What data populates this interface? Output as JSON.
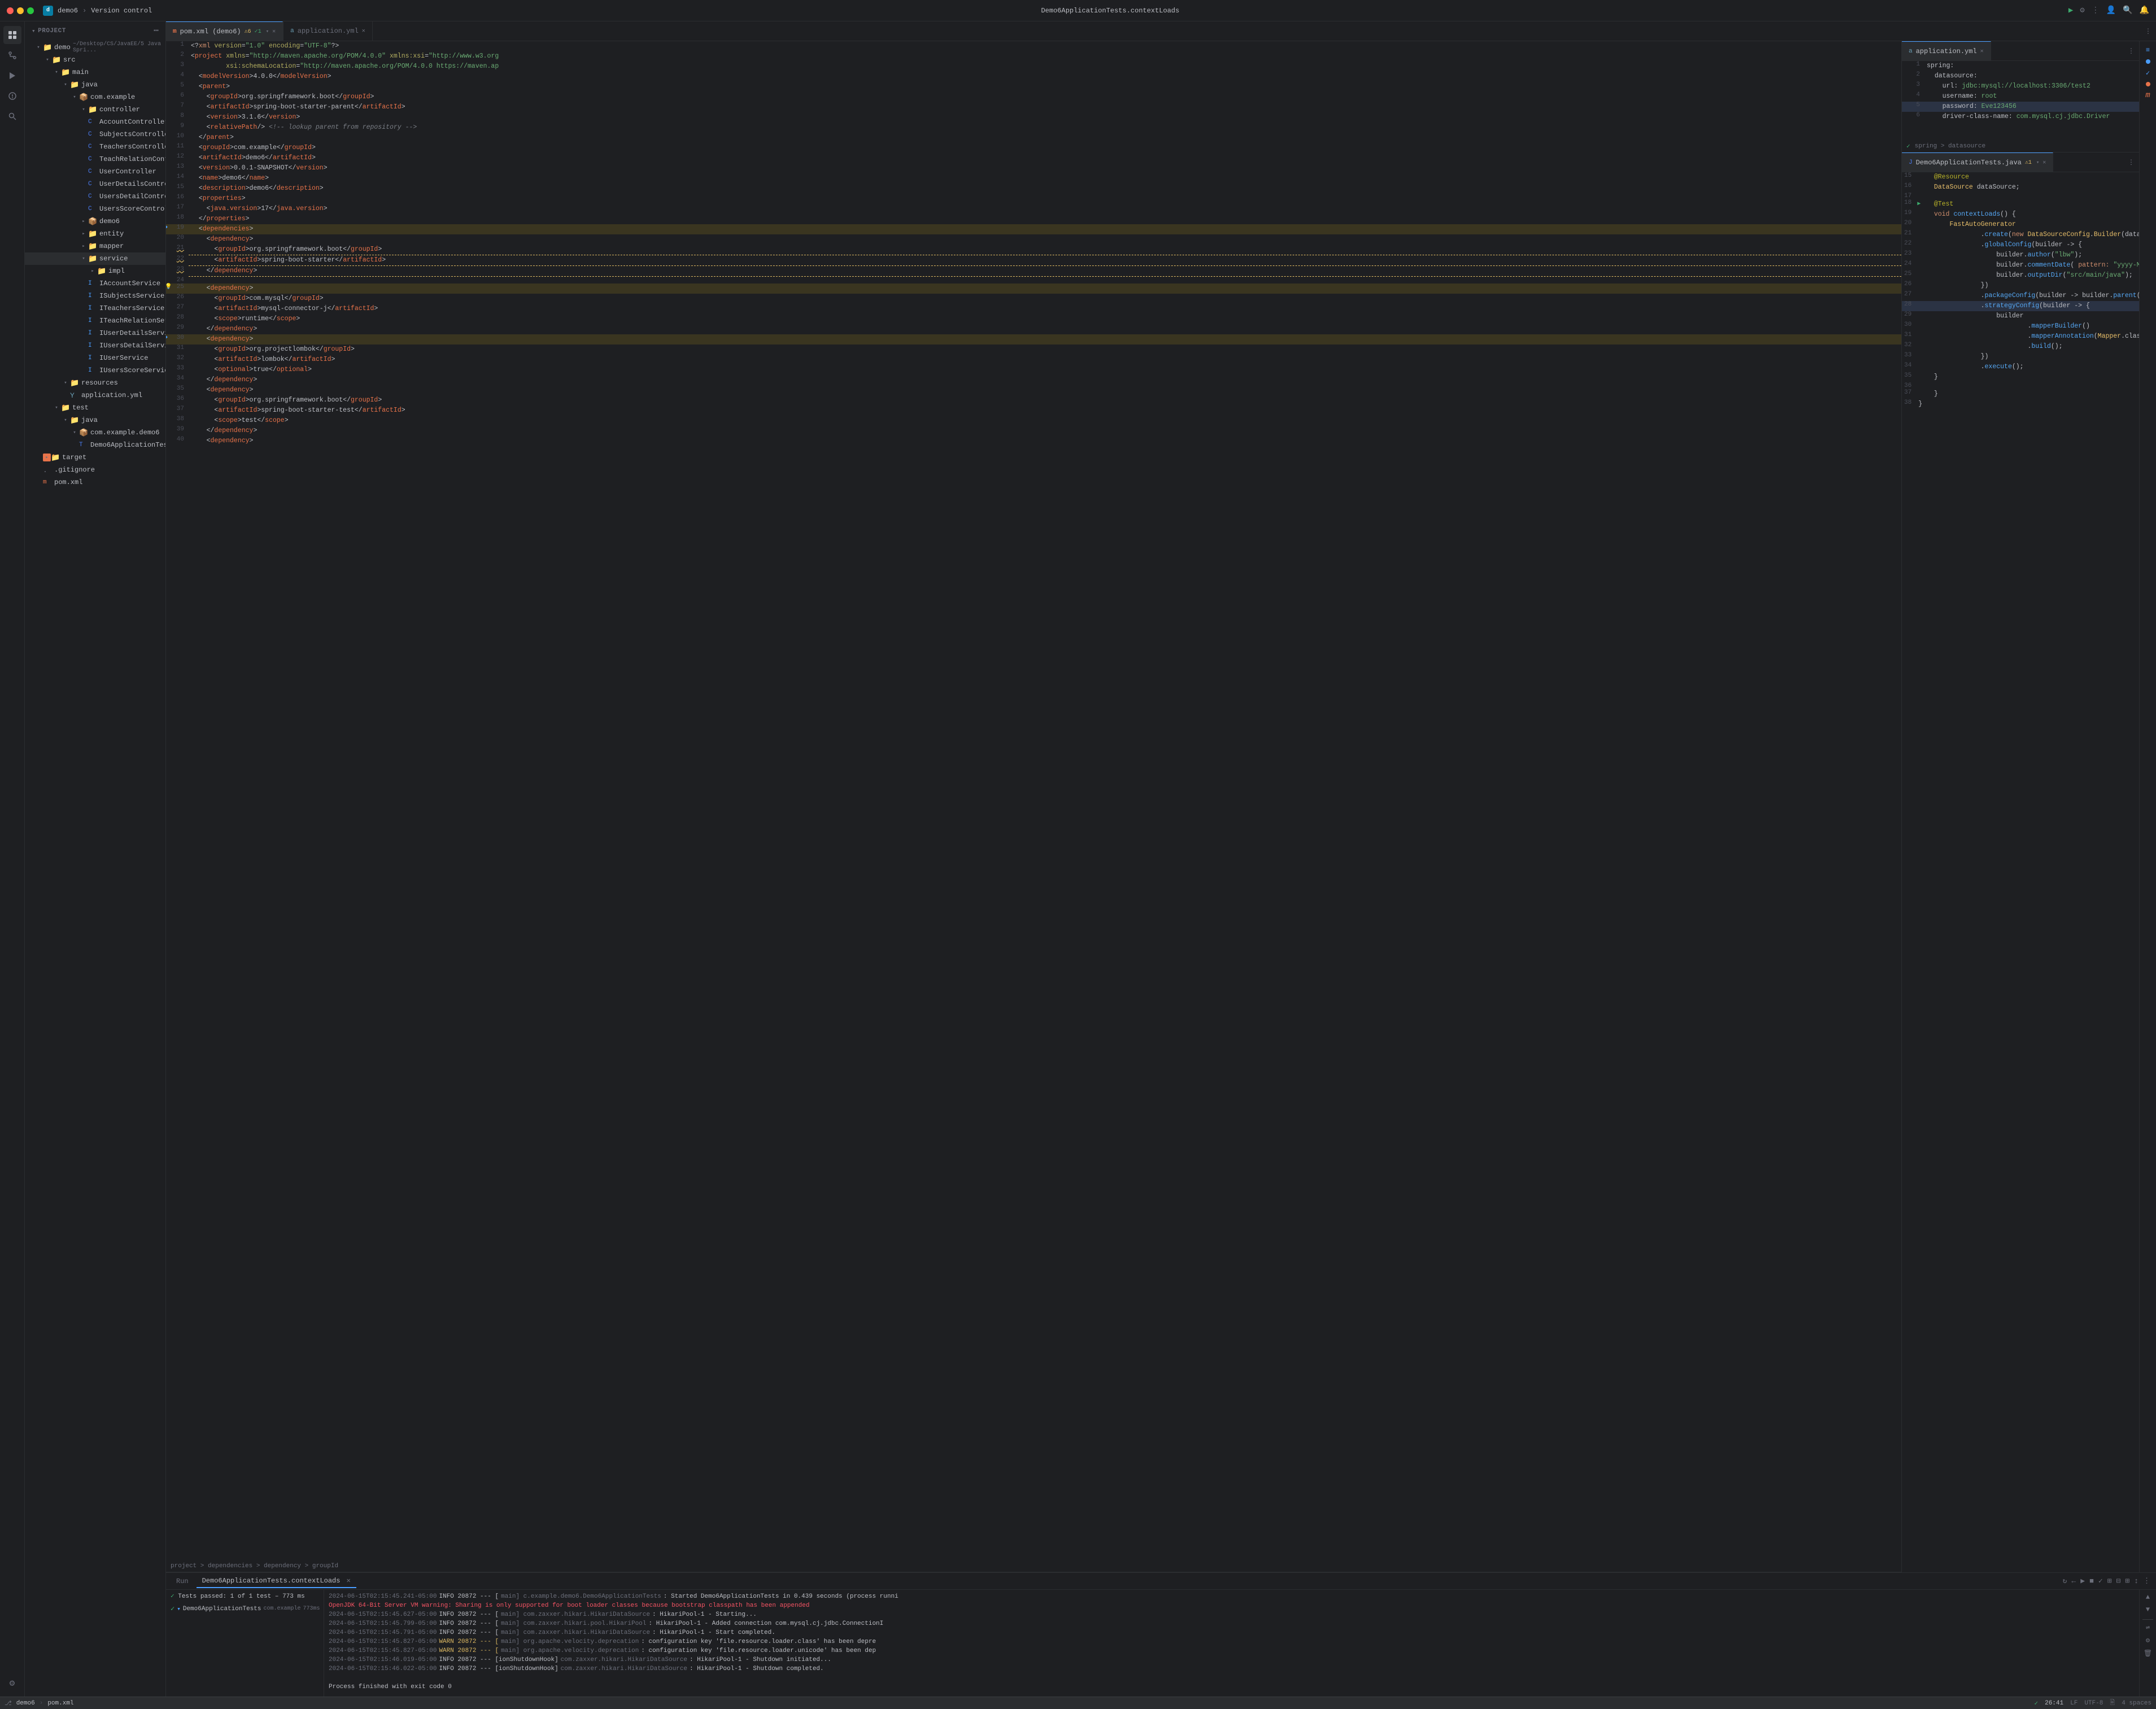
{
  "titlebar": {
    "project": "demo6",
    "version_control": "Version control",
    "center_title": "Demo6ApplicationTests.contextLoads",
    "run_icon": "▶",
    "settings_icon": "⚙",
    "more_icon": "⋮",
    "user_icon": "👤",
    "search_icon": "🔍",
    "notifications_icon": "🔔"
  },
  "sidebar": {
    "header": "Project",
    "project_name": "demo6",
    "project_path": "~/Desktop/CS/JavaEE/5 Java Spri...",
    "tree": [
      {
        "id": "demo6-root",
        "label": "demo6",
        "type": "root",
        "indent": 0,
        "expanded": true
      },
      {
        "id": "src",
        "label": "src",
        "type": "folder",
        "indent": 1,
        "expanded": true
      },
      {
        "id": "main",
        "label": "main",
        "type": "folder",
        "indent": 2,
        "expanded": true
      },
      {
        "id": "java",
        "label": "java",
        "type": "folder",
        "indent": 3,
        "expanded": true
      },
      {
        "id": "com.example",
        "label": "com.example",
        "type": "package",
        "indent": 4,
        "expanded": true
      },
      {
        "id": "controller",
        "label": "controller",
        "type": "folder",
        "indent": 5,
        "expanded": true
      },
      {
        "id": "AccountController",
        "label": "AccountController",
        "type": "java",
        "indent": 6
      },
      {
        "id": "SubjectsController",
        "label": "SubjectsController",
        "type": "java",
        "indent": 6
      },
      {
        "id": "TeachersController",
        "label": "TeachersController",
        "type": "java",
        "indent": 6
      },
      {
        "id": "TeachRelationController",
        "label": "TeachRelationController",
        "type": "java",
        "indent": 6
      },
      {
        "id": "UserController",
        "label": "UserController",
        "type": "java",
        "indent": 6
      },
      {
        "id": "UserDetailsController",
        "label": "UserDetailsController",
        "type": "java",
        "indent": 6
      },
      {
        "id": "UsersDetailController",
        "label": "UsersDetailController",
        "type": "java",
        "indent": 6
      },
      {
        "id": "UsersScoreController",
        "label": "UsersScoreController",
        "type": "java",
        "indent": 6
      },
      {
        "id": "demo6-pkg",
        "label": "demo6",
        "type": "package",
        "indent": 5,
        "expanded": false
      },
      {
        "id": "entity",
        "label": "entity",
        "type": "folder",
        "indent": 5,
        "expanded": false
      },
      {
        "id": "mapper",
        "label": "mapper",
        "type": "folder",
        "indent": 5,
        "expanded": false
      },
      {
        "id": "service",
        "label": "service",
        "type": "folder",
        "indent": 5,
        "expanded": true
      },
      {
        "id": "impl",
        "label": "impl",
        "type": "folder",
        "indent": 6,
        "expanded": false
      },
      {
        "id": "IAccountService",
        "label": "IAccountService",
        "type": "interface",
        "indent": 6
      },
      {
        "id": "ISubjectsService",
        "label": "ISubjectsService",
        "type": "interface",
        "indent": 6
      },
      {
        "id": "ITeachersService",
        "label": "ITeachersService",
        "type": "interface",
        "indent": 6
      },
      {
        "id": "ITeachRelationService",
        "label": "ITeachRelationService",
        "type": "interface",
        "indent": 6
      },
      {
        "id": "IUserDetailsService",
        "label": "IUserDetailsService",
        "type": "interface",
        "indent": 6
      },
      {
        "id": "IUsersDetailService",
        "label": "IUsersDetailService",
        "type": "interface",
        "indent": 6
      },
      {
        "id": "IUserService",
        "label": "IUserService",
        "type": "interface",
        "indent": 6
      },
      {
        "id": "IUsersScoreService",
        "label": "IUsersScoreService",
        "type": "interface",
        "indent": 6
      },
      {
        "id": "resources",
        "label": "resources",
        "type": "folder",
        "indent": 3,
        "expanded": true
      },
      {
        "id": "application.yml",
        "label": "application.yml",
        "type": "yaml",
        "indent": 4
      },
      {
        "id": "test",
        "label": "test",
        "type": "folder",
        "indent": 2,
        "expanded": true
      },
      {
        "id": "java-test",
        "label": "java",
        "type": "folder",
        "indent": 3,
        "expanded": true
      },
      {
        "id": "com.example.demo6",
        "label": "com.example.demo6",
        "type": "package",
        "indent": 4,
        "expanded": true
      },
      {
        "id": "Demo6ApplicationTests",
        "label": "Demo6ApplicationTests",
        "type": "java",
        "indent": 5
      },
      {
        "id": "target",
        "label": "target",
        "type": "folder",
        "indent": 1,
        "expanded": false
      },
      {
        "id": ".gitignore",
        "label": ".gitignore",
        "type": "git",
        "indent": 1
      },
      {
        "id": "pom.xml",
        "label": "pom.xml",
        "type": "xml",
        "indent": 1
      }
    ]
  },
  "editor": {
    "tabs": [
      {
        "id": "pom-xml",
        "label": "pom.xml (demo6)",
        "type": "xml",
        "active": true,
        "modified": false
      },
      {
        "id": "application-yml",
        "label": "application.yml",
        "type": "yaml",
        "active": false,
        "modified": false
      },
      {
        "id": "demo6-tests",
        "label": "Demo6ApplicationTests.java",
        "type": "java",
        "active": false,
        "modified": false
      }
    ],
    "pom_lines": [
      {
        "n": 1,
        "code": "<?xml version=\"1.0\" encoding=\"UTF-8\"?>"
      },
      {
        "n": 2,
        "code": "<project xmlns=\"http://maven.apache.org/POM/4.0.0\" xmlns:xsi=\"http://www.w3.org"
      },
      {
        "n": 3,
        "code": "         xsi:schemaLocation=\"http://maven.apache.org/POM/4.0.0 https://maven.ap"
      },
      {
        "n": 4,
        "code": "  <modelVersion>4.0.0</modelVersion>"
      },
      {
        "n": 5,
        "code": "  <parent>"
      },
      {
        "n": 6,
        "code": "    <groupId>org.springframework.boot</groupId>"
      },
      {
        "n": 7,
        "code": "    <artifactId>spring-boot-starter-parent</artifactId>"
      },
      {
        "n": 8,
        "code": "    <version>3.1.6</version>"
      },
      {
        "n": 9,
        "code": "    <relativePath/> <!-- lookup parent from repository -->"
      },
      {
        "n": 10,
        "code": "  </parent>"
      },
      {
        "n": 11,
        "code": "  <groupId>com.example</groupId>"
      },
      {
        "n": 12,
        "code": "  <artifactId>demo6</artifactId>"
      },
      {
        "n": 13,
        "code": "  <version>0.0.1-SNAPSHOT</version>"
      },
      {
        "n": 14,
        "code": "  <name>demo6</name>"
      },
      {
        "n": 15,
        "code": "  <description>demo6</description>"
      },
      {
        "n": 16,
        "code": "  <properties>"
      },
      {
        "n": 17,
        "code": "    <java.version>17</java.version>"
      },
      {
        "n": 18,
        "code": "  </properties>"
      },
      {
        "n": 19,
        "code": "  <dependencies>"
      },
      {
        "n": 20,
        "code": "    <dependency>"
      },
      {
        "n": 21,
        "code": "      <groupId>org.springframework.boot</groupId>"
      },
      {
        "n": 22,
        "code": "      <artifactId>spring-boot-starter</artifactId>"
      },
      {
        "n": 23,
        "code": "    </dependency>"
      },
      {
        "n": 24,
        "code": ""
      },
      {
        "n": 25,
        "code": "    <dependency>"
      },
      {
        "n": 26,
        "code": "      <groupId>com.mysql</groupId>"
      },
      {
        "n": 27,
        "code": "      <artifactId>mysql-connector-j</artifactId>"
      },
      {
        "n": 28,
        "code": "      <scope>runtime</scope>"
      },
      {
        "n": 29,
        "code": "    </dependency>"
      },
      {
        "n": 30,
        "code": "    <dependency>"
      },
      {
        "n": 31,
        "code": "      <groupId>org.projectlombok</groupId>"
      },
      {
        "n": 32,
        "code": "      <artifactId>lombok</artifactId>"
      },
      {
        "n": 33,
        "code": "      <optional>true</optional>"
      },
      {
        "n": 34,
        "code": "    </dependency>"
      },
      {
        "n": 35,
        "code": "    <dependency>"
      },
      {
        "n": 36,
        "code": "      <groupId>org.springframework.boot</groupId>"
      },
      {
        "n": 37,
        "code": "      <artifactId>spring-boot-starter-test</artifactId>"
      },
      {
        "n": 38,
        "code": "      <scope>test</scope>"
      },
      {
        "n": 39,
        "code": "    </dependency>"
      },
      {
        "n": 40,
        "code": "    <dependency>"
      }
    ],
    "pom_breadcrumb": "project > dependencies > dependency > groupId",
    "yaml_lines": [
      {
        "n": 1,
        "code": "spring:"
      },
      {
        "n": 2,
        "code": "  datasource:"
      },
      {
        "n": 3,
        "code": "    url: jdbc:mysql://localhost:3306/test2"
      },
      {
        "n": 4,
        "code": "    username: root"
      },
      {
        "n": 5,
        "code": "    password: Eve123456"
      },
      {
        "n": 6,
        "code": "    driver-class-name: com.mysql.cj.jdbc.Driver"
      }
    ],
    "yaml_breadcrumb": "spring > datasource",
    "java_lines": [
      {
        "n": 15,
        "code": "    @Resource"
      },
      {
        "n": 16,
        "code": "    DataSource dataSource;"
      },
      {
        "n": 17,
        "code": ""
      },
      {
        "n": 18,
        "code": "    @Test"
      },
      {
        "n": 19,
        "code": "    void contextLoads() {"
      },
      {
        "n": 20,
        "code": "        FastAutoGenerator"
      },
      {
        "n": 21,
        "code": "                .create(new DataSourceConfig.Builder(dataSource))"
      },
      {
        "n": 22,
        "code": "                .globalConfig(builder -> {"
      },
      {
        "n": 23,
        "code": "                    builder.author(\"lbw\");"
      },
      {
        "n": 24,
        "code": "                    builder.commentDate( pattern: \"yyyy-MM-dd\");"
      },
      {
        "n": 25,
        "code": "                    builder.outputDir(\"src/main/java\");"
      },
      {
        "n": 26,
        "code": "                })"
      },
      {
        "n": 27,
        "code": "                .packageConfig(builder -> builder.parent(\"com.example\"))"
      },
      {
        "n": 28,
        "code": "                .strategyConfig(builder -> {"
      },
      {
        "n": 29,
        "code": "                    builder"
      },
      {
        "n": 30,
        "code": "                            .mapperBuilder()"
      },
      {
        "n": 31,
        "code": "                            .mapperAnnotation(Mapper.class)"
      },
      {
        "n": 32,
        "code": "                            .build();"
      },
      {
        "n": 33,
        "code": "                })"
      },
      {
        "n": 34,
        "code": "                .execute();"
      },
      {
        "n": 35,
        "code": "    }"
      },
      {
        "n": 36,
        "code": ""
      },
      {
        "n": 37,
        "code": "    }"
      },
      {
        "n": 38,
        "code": "}"
      }
    ]
  },
  "bottom_panel": {
    "tabs": [
      "Run",
      "Demo6ApplicationTests.contextLoads"
    ],
    "active_tab": "Demo6ApplicationTests.contextLoads",
    "test_result": "Tests passed: 1 of 1 test – 773 ms",
    "logs": [
      {
        "time": "2024-06-15T02:15:45.241-05:00",
        "level": "INFO",
        "pid": "20872",
        "thread": "---  [",
        "src": "main] c.example.demo6.Demo6ApplicationTests",
        "msg": ": Started Demo6ApplicationTests in 0.439 seconds (process runni"
      },
      {
        "time": "OpenJDK 64-Bit Server VM warning:",
        "level": "warn-full",
        "msg": "Sharing is only supported for boot loader classes because bootstrap classpath has been appended"
      },
      {
        "time": "2024-06-15T02:15:45.627-05:00",
        "level": "INFO",
        "pid": "20872",
        "thread": "---  [",
        "src": "main] com.zaxxer.hikari.HikariDataSource",
        "msg": ": HikariPool-1 - Starting..."
      },
      {
        "time": "2024-06-15T02:15:45.799-05:00",
        "level": "INFO",
        "pid": "20872",
        "thread": "---  [",
        "src": "main] com.zaxxer.hikari.pool.HikariPool",
        "msg": ": HikariPool-1 - Added connection com.mysql.cj.jdbc.ConnectionI"
      },
      {
        "time": "2024-06-15T02:15:45.791-05:00",
        "level": "INFO",
        "pid": "20872",
        "thread": "---  [",
        "src": "main] com.zaxxer.hikari.HikariDataSource",
        "msg": ": HikariPool-1 - Start completed."
      },
      {
        "time": "2024-06-15T02:15:45.827-05:00",
        "level": "WARN",
        "pid": "20872",
        "thread": "---  [",
        "src": "main] org.apache.velocity.deprecation",
        "msg": ": configuration key 'file.resource.loader.class' has been depre"
      },
      {
        "time": "2024-06-15T02:15:45.827-05:00",
        "level": "WARN",
        "pid": "20872",
        "thread": "---  [",
        "src": "main] org.apache.velocity.deprecation",
        "msg": ": configuration key 'file.resource.loader.unicode' has been dep"
      },
      {
        "time": "2024-06-15T02:15:46.019-05:00",
        "level": "INFO",
        "pid": "20872",
        "thread": "---  [ionShutdownHook]",
        "src": "com.zaxxer.hikari.HikariDataSource",
        "msg": ": HikariPool-1 - Shutdown initiated..."
      },
      {
        "time": "2024-06-15T02:15:46.022-05:00",
        "level": "INFO",
        "pid": "20872",
        "thread": "---  [ionShutdownHook]",
        "src": "com.zaxxer.hikari.HikariDataSource",
        "msg": ": HikariPool-1 - Shutdown completed."
      },
      {
        "time": "",
        "level": "",
        "msg": ""
      },
      {
        "time": "Process finished with exit code 0",
        "level": "",
        "msg": ""
      }
    ]
  },
  "status_bar": {
    "git": "demo6",
    "file": "pom.xml",
    "cursor": "26:41",
    "line_ending": "LF",
    "encoding": "UTF-8",
    "indent": "4 spaces"
  },
  "colors": {
    "bg": "#1e1f22",
    "sidebar_bg": "#1e1f22",
    "editor_bg": "#1e1f22",
    "active_tab_bg": "#2b2d30",
    "border": "#2b2d30",
    "accent": "#4a9eff",
    "text": "#bcbec4",
    "dim_text": "#6c6f7b",
    "green": "#3daa6d",
    "red": "#f75464",
    "yellow": "#dcb862",
    "orange": "#e8734a"
  }
}
